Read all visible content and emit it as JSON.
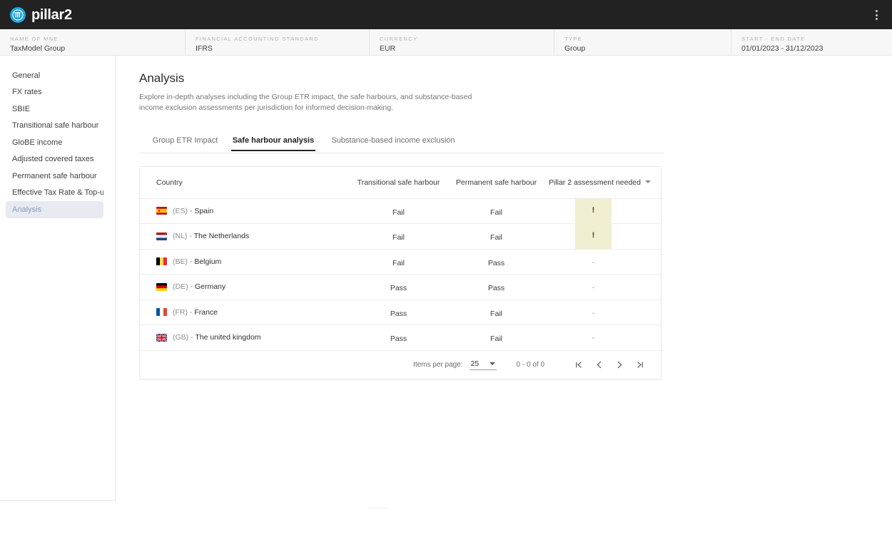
{
  "topbar": {
    "brand_name": "pillar2",
    "menu_icon": "kebab-menu-icon"
  },
  "infostrip": [
    {
      "label": "NAME OF MNE",
      "value": "TaxModel Group"
    },
    {
      "label": "FINANCIAL ACCOUNTING STANDARD",
      "value": "IFRS"
    },
    {
      "label": "CURRENCY",
      "value": "EUR"
    },
    {
      "label": "TYPE",
      "value": "Group"
    },
    {
      "label": "START - END DATE",
      "value": "01/01/2023 - 31/12/2023"
    }
  ],
  "sidebar": {
    "items": [
      {
        "label": "General",
        "selected": false
      },
      {
        "label": "FX rates",
        "selected": false
      },
      {
        "label": "SBIE",
        "selected": false
      },
      {
        "label": "Transitional safe harbour",
        "selected": false
      },
      {
        "label": "GloBE income",
        "selected": false
      },
      {
        "label": "Adjusted covered taxes",
        "selected": false
      },
      {
        "label": "Permanent safe harbour",
        "selected": false
      },
      {
        "label": "Effective Tax Rate & Top-up...",
        "selected": false
      },
      {
        "label": "Analysis",
        "selected": true
      }
    ]
  },
  "main": {
    "title": "Analysis",
    "description": "Explore in-depth analyses including the Group ETR impact, the safe harbours, and substance-based income exclusion assessments per jurisdiction for informed decision-making.",
    "tabs": [
      {
        "label": "Group ETR Impact",
        "active": false
      },
      {
        "label": "Safe harbour analysis",
        "active": true
      },
      {
        "label": "Substance-based income exclusion",
        "active": false
      }
    ]
  },
  "table": {
    "columns": [
      "Country",
      "Transitional safe harbour",
      "Permanent safe harbour",
      "Pillar 2 assessment needed"
    ],
    "sort_column": "Pillar 2 assessment needed",
    "sort_icon": "sort-descending-caret-icon",
    "rows": [
      {
        "iso": "(ES)",
        "separator": " - ",
        "country": "Spain",
        "flag": "flag-es",
        "transitional_safe_harbour": "Fail",
        "permanent_safe_harbour": "Fail",
        "pillar2_assessment_needed": "!",
        "highlighted": true
      },
      {
        "iso": "(NL)",
        "separator": " - ",
        "country": "The Netherlands",
        "flag": "flag-nl",
        "transitional_safe_harbour": "Fail",
        "permanent_safe_harbour": "Fail",
        "pillar2_assessment_needed": "!",
        "highlighted": true
      },
      {
        "iso": "(BE)",
        "separator": " - ",
        "country": "Belgium",
        "flag": "flag-be",
        "transitional_safe_harbour": "Fail",
        "permanent_safe_harbour": "Pass",
        "pillar2_assessment_needed": "-",
        "highlighted": false
      },
      {
        "iso": "(DE)",
        "separator": " - ",
        "country": "Germany",
        "flag": "flag-de",
        "transitional_safe_harbour": "Pass",
        "permanent_safe_harbour": "Pass",
        "pillar2_assessment_needed": "-",
        "highlighted": false
      },
      {
        "iso": "(FR)",
        "separator": " - ",
        "country": "France",
        "flag": "flag-fr",
        "transitional_safe_harbour": "Pass",
        "permanent_safe_harbour": "Fail",
        "pillar2_assessment_needed": "-",
        "highlighted": false
      },
      {
        "iso": "(GB)",
        "separator": " - ",
        "country": "The united kingdom",
        "flag": "flag-gb",
        "transitional_safe_harbour": "Pass",
        "permanent_safe_harbour": "Fail",
        "pillar2_assessment_needed": "-",
        "highlighted": false
      }
    ]
  },
  "paginator": {
    "items_per_page_label": "Items per page:",
    "items_per_page_value": "25",
    "range_label": "0 - 0 of 0",
    "first_page_icon": "first-page-icon",
    "prev_page_icon": "previous-page-icon",
    "next_page_icon": "next-page-icon",
    "last_page_icon": "last-page-icon"
  },
  "colors": {
    "topbar_bg": "#222222",
    "brand_accent": "#1ba7e0",
    "selected_nav_bg": "#e7eaf1",
    "warning_cell_bg": "#f0efd2",
    "tab_underline": "#232323"
  }
}
